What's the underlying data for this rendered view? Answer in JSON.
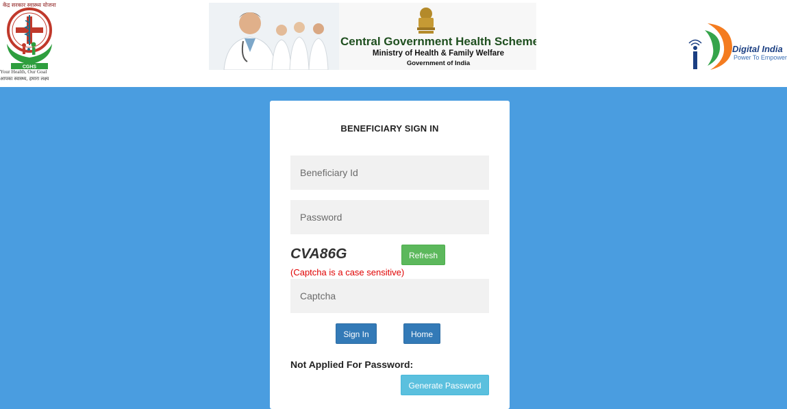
{
  "header": {
    "cghs_logo": {
      "hindi_top": "केंद्र सरकार स्वास्थ्य योजना",
      "tagline_en": "Your Health, Our Goal",
      "tagline_hi": "आपका स्वास्थ्य, हमारा लक्ष्य",
      "badge": "CGHS"
    },
    "banner": {
      "title": "Central Government Health Scheme",
      "subtitle": "Ministry of Health & Family Welfare",
      "subtitle2": "Government of India"
    },
    "digital_india": {
      "name": "Digital India",
      "tagline": "Power To Empower"
    }
  },
  "signin": {
    "title": "BENEFICIARY SIGN IN",
    "beneficiary_id_placeholder": "Beneficiary Id",
    "beneficiary_id_value": "",
    "password_placeholder": "Password",
    "password_value": "",
    "captcha_code": "CVA86G",
    "refresh_label": "Refresh",
    "captcha_note": "(Captcha is a case sensitive)",
    "captcha_placeholder": "Captcha",
    "captcha_value": "",
    "signin_label": "Sign In",
    "home_label": "Home",
    "not_applied_label": "Not Applied For Password:",
    "generate_password_label": "Generate Password"
  },
  "colors": {
    "page_bg": "#4a9de0",
    "refresh_green": "#5cb85c",
    "primary_blue": "#337ab7",
    "info_cyan": "#5bc0de",
    "error_red": "#e00000"
  }
}
